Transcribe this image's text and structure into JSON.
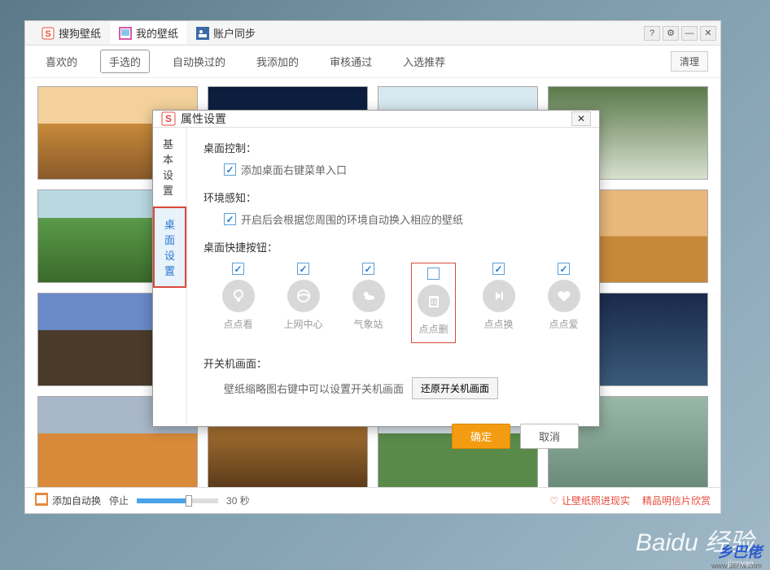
{
  "mainTabs": [
    {
      "label": "搜狗壁纸",
      "icon": "sogou"
    },
    {
      "label": "我的壁纸",
      "icon": "gallery"
    },
    {
      "label": "账户同步",
      "icon": "sync"
    }
  ],
  "subTabs": [
    "喜欢的",
    "手选的",
    "自动换过的",
    "我添加的",
    "审核通过",
    "入选推荐"
  ],
  "activeSubTab": 1,
  "clearBtn": "清理",
  "bottomBar": {
    "addAuto": "添加自动换",
    "stop": "停止",
    "duration": "30 秒",
    "link1": "让壁纸照进现实",
    "link2": "精品明信片欣赏"
  },
  "dialog": {
    "title": "属性设置",
    "sideTabs": [
      "基本设置",
      "桌面设置"
    ],
    "activeSide": 1,
    "sections": {
      "desktopControl": {
        "title": "桌面控制：",
        "item": "添加桌面右键菜单入口"
      },
      "envSense": {
        "title": "环境感知：",
        "item": "开启后会根据您周围的环境自动换入相应的壁纸"
      },
      "shortcuts": {
        "title": "桌面快捷按钮：",
        "items": [
          {
            "label": "点点看",
            "checked": true,
            "icon": "bulb"
          },
          {
            "label": "上网中心",
            "checked": true,
            "icon": "ie"
          },
          {
            "label": "气象站",
            "checked": true,
            "icon": "weather"
          },
          {
            "label": "点点删",
            "checked": false,
            "icon": "trash",
            "highlight": true
          },
          {
            "label": "点点换",
            "checked": true,
            "icon": "next"
          },
          {
            "label": "点点爱",
            "checked": true,
            "icon": "heart"
          }
        ]
      },
      "power": {
        "title": "开关机画面：",
        "hint": "壁纸缩略图右键中可以设置开关机画面",
        "btn": "还原开关机画面"
      }
    },
    "okBtn": "确定",
    "cancelBtn": "取消"
  },
  "watermark": {
    "main": "Baidu 经验",
    "sub": "jingyan"
  },
  "corner": "乡巴佬"
}
